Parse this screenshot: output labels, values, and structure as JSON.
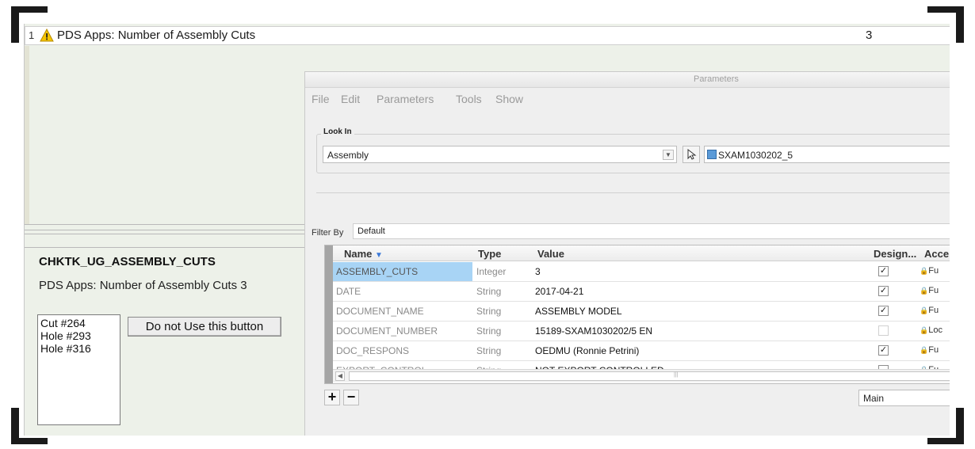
{
  "check_result": {
    "index": "1",
    "title": "PDS Apps: Number of Assembly Cuts",
    "count": "3"
  },
  "info": {
    "check_name": "CHKTK_UG_ASSEMBLY_CUTS",
    "summary": "PDS Apps: Number of Assembly Cuts 3",
    "list": [
      "Cut #264",
      "Hole #293",
      "Hole #316"
    ],
    "button_label": "Do not Use this button"
  },
  "dialog": {
    "title": "Parameters",
    "menu": [
      "File",
      "Edit",
      "Parameters",
      "Tools",
      "Show"
    ],
    "look_in_label": "Look In",
    "look_in_value": "Assembly",
    "model_name": "SXAM1030202_5",
    "filter_label": "Filter By",
    "filter_value": "Default",
    "columns": [
      "Name",
      "Type",
      "Value",
      "Design...",
      "Acce"
    ],
    "rows": [
      {
        "name": "ASSEMBLY_CUTS",
        "type": "Integer",
        "value": "3",
        "designated": true,
        "access": "Fu"
      },
      {
        "name": "DATE",
        "type": "String",
        "value": "2017-04-21",
        "designated": true,
        "access": "Fu"
      },
      {
        "name": "DOCUMENT_NAME",
        "type": "String",
        "value": "ASSEMBLY MODEL",
        "designated": true,
        "access": "Fu"
      },
      {
        "name": "DOCUMENT_NUMBER",
        "type": "String",
        "value": "15189-SXAM1030202/5 EN",
        "designated": false,
        "access": "Loc"
      },
      {
        "name": "DOC_RESPONS",
        "type": "String",
        "value": "OEDMU (Ronnie Petrini)",
        "designated": true,
        "access": "Fu"
      },
      {
        "name": "EXPORT_CONTROL",
        "type": "String",
        "value": "NOT EXPORT CONTROLLED",
        "designated": false,
        "access": "Fu"
      }
    ],
    "view_select": "Main",
    "colors": {
      "selected_cell": "#a8d4f5",
      "background": "#edf1e9"
    }
  }
}
